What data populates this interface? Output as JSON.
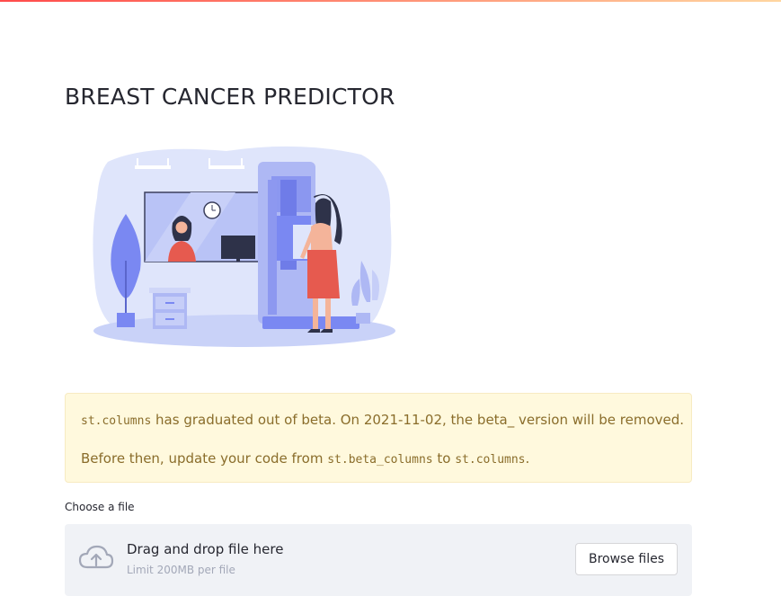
{
  "header": {
    "title": "BREAST CANCER PREDICTOR"
  },
  "alert": {
    "line1": {
      "code": "st.columns",
      "text": " has graduated out of beta. On 2021-11-02, the beta_ version will be removed."
    },
    "line2": {
      "prefix": "Before then, update your code from ",
      "code_old": "st.beta_columns",
      "middle": " to ",
      "code_new": "st.columns",
      "suffix": "."
    }
  },
  "uploader": {
    "label": "Choose a file",
    "drop_title": "Drag and drop file here",
    "limit_text": "Limit 200MB per file",
    "browse_label": "Browse files",
    "icon": "cloud-upload-icon"
  },
  "colors": {
    "accent": "#ff4b4b",
    "alert_bg": "#fff9dd",
    "alert_text": "#8a6d2b",
    "dropzone_bg": "#f0f2f6",
    "illustration_primary": "#7a88f2",
    "illustration_light": "#dde3fb"
  }
}
